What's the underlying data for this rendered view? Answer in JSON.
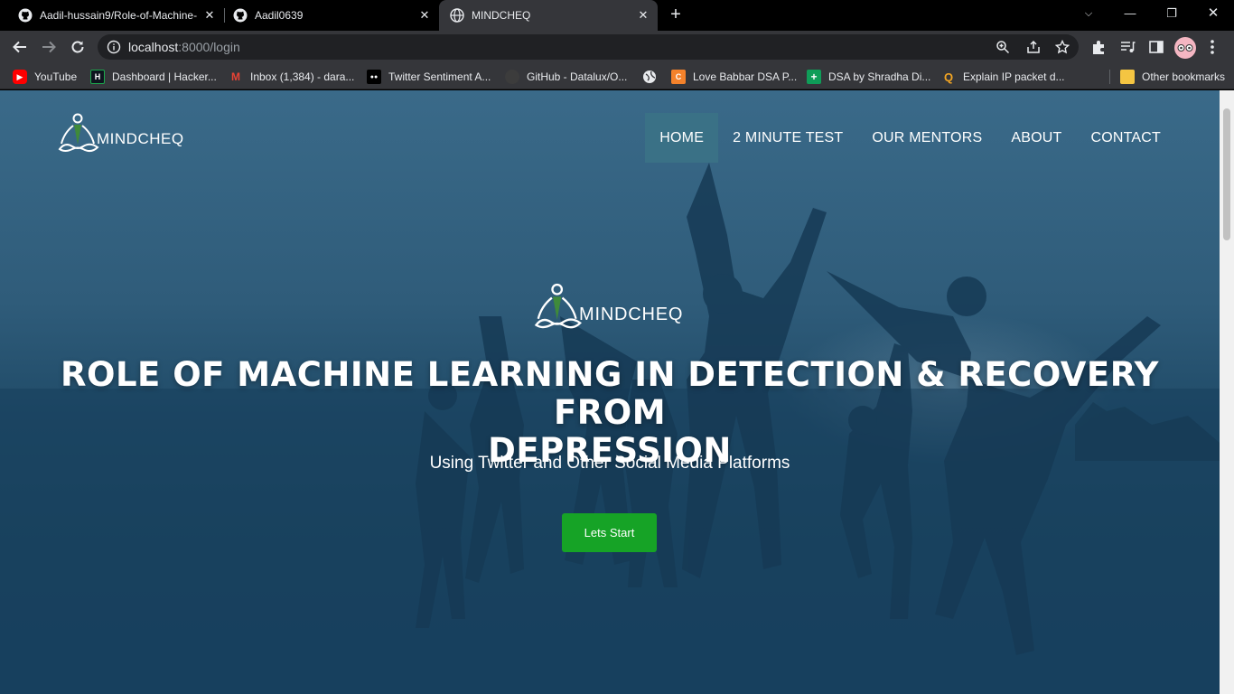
{
  "browser": {
    "tabs": [
      {
        "title": "Aadil-hussain9/Role-of-Machine-",
        "icon": "github-icon"
      },
      {
        "title": "Aadil0639",
        "icon": "github-icon"
      },
      {
        "title": "MINDCHEQ",
        "icon": "globe-icon",
        "active": true
      }
    ],
    "address": {
      "host": "localhost",
      "rest": ":8000/login"
    },
    "bookmarks": [
      {
        "label": "YouTube",
        "icon": "youtube-icon",
        "color": "#ff0000"
      },
      {
        "label": "Dashboard | Hacker...",
        "icon": "hackerrank-icon",
        "color": "#1ba94c",
        "glyph": "H"
      },
      {
        "label": "Inbox (1,384) - dara...",
        "icon": "gmail-icon",
        "color": "#ea4335",
        "glyph": "M"
      },
      {
        "label": "Twitter Sentiment A...",
        "icon": "medium-icon",
        "color": "#ffffff",
        "glyph": "●●"
      },
      {
        "label": "GitHub - Datalux/O...",
        "icon": "github-icon",
        "color": "#444"
      },
      {
        "label": "",
        "icon": "globe-icon",
        "color": "#9aa0a6"
      },
      {
        "label": "Love Babbar DSA P...",
        "icon": "codestudio-icon",
        "color": "#f4822b",
        "glyph": "C"
      },
      {
        "label": "DSA by Shradha Di...",
        "icon": "sheets-icon",
        "color": "#0f9d58",
        "glyph": "+"
      },
      {
        "label": "Explain IP packet d...",
        "icon": "quora-icon",
        "color": "#f4a623",
        "glyph": "Q"
      }
    ],
    "other_bookmarks": "Other bookmarks"
  },
  "page": {
    "brand": "MINDCHEQ",
    "nav": [
      {
        "label": "HOME",
        "active": true
      },
      {
        "label": "2 MINUTE TEST"
      },
      {
        "label": "OUR MENTORS"
      },
      {
        "label": "ABOUT"
      },
      {
        "label": "CONTACT"
      }
    ],
    "hero": {
      "logo_text": "MINDCHEQ",
      "title_line1": "ROLE OF MACHINE LEARNING IN DETECTION & RECOVERY FROM",
      "title_line2": "DEPRESSION",
      "subtitle": "Using Twitter and Other Social Media Platforms",
      "cta": "Lets Start"
    },
    "accent": "#16a326",
    "overlay": "#1f4a67"
  }
}
